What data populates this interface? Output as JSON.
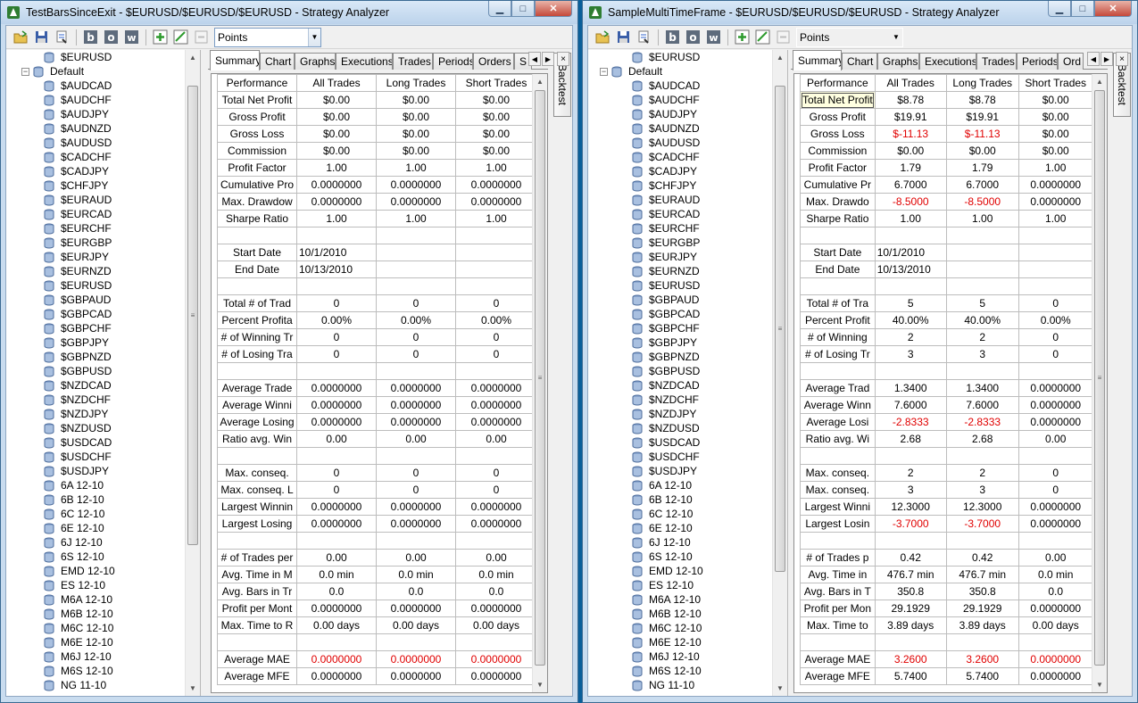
{
  "left_window": {
    "title": "TestBarsSinceExit - $EURUSD/$EURUSD/$EURUSD - Strategy Analyzer",
    "toolbar": {
      "mode_select_value": "Points"
    },
    "tree": {
      "top_item": "$EURUSD",
      "group_label": "Default",
      "items": [
        "$AUDCAD",
        "$AUDCHF",
        "$AUDJPY",
        "$AUDNZD",
        "$AUDUSD",
        "$CADCHF",
        "$CADJPY",
        "$CHFJPY",
        "$EURAUD",
        "$EURCAD",
        "$EURCHF",
        "$EURGBP",
        "$EURJPY",
        "$EURNZD",
        "$EURUSD",
        "$GBPAUD",
        "$GBPCAD",
        "$GBPCHF",
        "$GBPJPY",
        "$GBPNZD",
        "$GBPUSD",
        "$NZDCAD",
        "$NZDCHF",
        "$NZDJPY",
        "$NZDUSD",
        "$USDCAD",
        "$USDCHF",
        "$USDJPY",
        "6A 12-10",
        "6B 12-10",
        "6C 12-10",
        "6E 12-10",
        "6J 12-10",
        "6S 12-10",
        "EMD 12-10",
        "ES 12-10",
        "M6A 12-10",
        "M6B 12-10",
        "M6C 12-10",
        "M6E 12-10",
        "M6J 12-10",
        "M6S 12-10",
        "NG 11-10"
      ]
    },
    "tabs": [
      "Summary",
      "Chart",
      "Graphs",
      "Executions",
      "Trades",
      "Periods",
      "Orders",
      "S"
    ],
    "side_tab": "Backtest",
    "grid": {
      "headers": [
        "Performance",
        "All Trades",
        "Long Trades",
        "Short Trades"
      ],
      "rows": [
        {
          "label": "Total Net Profit",
          "all": "$0.00",
          "long": "$0.00",
          "short": "$0.00"
        },
        {
          "label": "Gross Profit",
          "all": "$0.00",
          "long": "$0.00",
          "short": "$0.00"
        },
        {
          "label": "Gross Loss",
          "all": "$0.00",
          "long": "$0.00",
          "short": "$0.00"
        },
        {
          "label": "Commission",
          "all": "$0.00",
          "long": "$0.00",
          "short": "$0.00"
        },
        {
          "label": "Profit Factor",
          "all": "1.00",
          "long": "1.00",
          "short": "1.00"
        },
        {
          "label": "Cumulative Pro",
          "all": "0.0000000",
          "long": "0.0000000",
          "short": "0.0000000"
        },
        {
          "label": "Max. Drawdow",
          "all": "0.0000000",
          "long": "0.0000000",
          "short": "0.0000000"
        },
        {
          "label": "Sharpe Ratio",
          "all": "1.00",
          "long": "1.00",
          "short": "1.00"
        },
        {
          "blank": true
        },
        {
          "label": "Start Date",
          "all": "10/1/2010",
          "long": "",
          "short": "",
          "left": true
        },
        {
          "label": "End Date",
          "all": "10/13/2010",
          "long": "",
          "short": "",
          "left": true
        },
        {
          "blank": true
        },
        {
          "label": "Total # of Trad",
          "all": "0",
          "long": "0",
          "short": "0"
        },
        {
          "label": "Percent Profita",
          "all": "0.00%",
          "long": "0.00%",
          "short": "0.00%"
        },
        {
          "label": "# of Winning Tr",
          "all": "0",
          "long": "0",
          "short": "0"
        },
        {
          "label": "# of Losing Tra",
          "all": "0",
          "long": "0",
          "short": "0"
        },
        {
          "blank": true
        },
        {
          "label": "Average Trade",
          "all": "0.0000000",
          "long": "0.0000000",
          "short": "0.0000000"
        },
        {
          "label": "Average Winni",
          "all": "0.0000000",
          "long": "0.0000000",
          "short": "0.0000000"
        },
        {
          "label": "Average Losing",
          "all": "0.0000000",
          "long": "0.0000000",
          "short": "0.0000000"
        },
        {
          "label": "Ratio avg. Win",
          "all": "0.00",
          "long": "0.00",
          "short": "0.00"
        },
        {
          "blank": true
        },
        {
          "label": "Max. conseq.",
          "all": "0",
          "long": "0",
          "short": "0"
        },
        {
          "label": "Max. conseq. L",
          "all": "0",
          "long": "0",
          "short": "0"
        },
        {
          "label": "Largest Winnin",
          "all": "0.0000000",
          "long": "0.0000000",
          "short": "0.0000000"
        },
        {
          "label": "Largest Losing",
          "all": "0.0000000",
          "long": "0.0000000",
          "short": "0.0000000"
        },
        {
          "blank": true
        },
        {
          "label": "# of Trades per",
          "all": "0.00",
          "long": "0.00",
          "short": "0.00"
        },
        {
          "label": "Avg. Time in M",
          "all": "0.0 min",
          "long": "0.0 min",
          "short": "0.0 min"
        },
        {
          "label": "Avg. Bars in Tr",
          "all": "0.0",
          "long": "0.0",
          "short": "0.0"
        },
        {
          "label": "Profit per Mont",
          "all": "0.0000000",
          "long": "0.0000000",
          "short": "0.0000000"
        },
        {
          "label": "Max. Time to R",
          "all": "0.00 days",
          "long": "0.00 days",
          "short": "0.00 days"
        },
        {
          "blank": true
        },
        {
          "label": "Average MAE",
          "all": "0.0000000",
          "long": "0.0000000",
          "short": "0.0000000",
          "red": true
        },
        {
          "label": "Average MFE",
          "all": "0.0000000",
          "long": "0.0000000",
          "short": "0.0000000"
        }
      ]
    }
  },
  "right_window": {
    "title": "SampleMultiTimeFrame - $EURUSD/$EURUSD/$EURUSD - Strategy Analyzer",
    "toolbar": {
      "mode_select_value": "Points"
    },
    "tree": {
      "top_item": "$EURUSD",
      "group_label": "Default",
      "items": [
        "$AUDCAD",
        "$AUDCHF",
        "$AUDJPY",
        "$AUDNZD",
        "$AUDUSD",
        "$CADCHF",
        "$CADJPY",
        "$CHFJPY",
        "$EURAUD",
        "$EURCAD",
        "$EURCHF",
        "$EURGBP",
        "$EURJPY",
        "$EURNZD",
        "$EURUSD",
        "$GBPAUD",
        "$GBPCAD",
        "$GBPCHF",
        "$GBPJPY",
        "$GBPNZD",
        "$GBPUSD",
        "$NZDCAD",
        "$NZDCHF",
        "$NZDJPY",
        "$NZDUSD",
        "$USDCAD",
        "$USDCHF",
        "$USDJPY",
        "6A 12-10",
        "6B 12-10",
        "6C 12-10",
        "6E 12-10",
        "6J 12-10",
        "6S 12-10",
        "EMD 12-10",
        "ES 12-10",
        "M6A 12-10",
        "M6B 12-10",
        "M6C 12-10",
        "M6E 12-10",
        "M6J 12-10",
        "M6S 12-10",
        "NG 11-10"
      ]
    },
    "tabs": [
      "Summary",
      "Chart",
      "Graphs",
      "Executions",
      "Trades",
      "Periods",
      "Ord"
    ],
    "side_tab": "Backtest",
    "grid": {
      "headers": [
        "Performance",
        "All Trades",
        "Long Trades",
        "Short Trades"
      ],
      "rows": [
        {
          "label": "Total Net Profit",
          "all": "$8.78",
          "long": "$8.78",
          "short": "$0.00",
          "selected": true
        },
        {
          "label": "Gross Profit",
          "all": "$19.91",
          "long": "$19.91",
          "short": "$0.00"
        },
        {
          "label": "Gross Loss",
          "all": "$-11.13",
          "long": "$-11.13",
          "short": "$0.00",
          "neg_all": true,
          "neg_long": true
        },
        {
          "label": "Commission",
          "all": "$0.00",
          "long": "$0.00",
          "short": "$0.00"
        },
        {
          "label": "Profit Factor",
          "all": "1.79",
          "long": "1.79",
          "short": "1.00"
        },
        {
          "label": "Cumulative Pr",
          "all": "6.7000",
          "long": "6.7000",
          "short": "0.0000000"
        },
        {
          "label": "Max. Drawdo",
          "all": "-8.5000",
          "long": "-8.5000",
          "short": "0.0000000",
          "neg_all": true,
          "neg_long": true
        },
        {
          "label": "Sharpe Ratio",
          "all": "1.00",
          "long": "1.00",
          "short": "1.00"
        },
        {
          "blank": true
        },
        {
          "label": "Start Date",
          "all": "10/1/2010",
          "long": "",
          "short": "",
          "left": true
        },
        {
          "label": "End Date",
          "all": "10/13/2010",
          "long": "",
          "short": "",
          "left": true
        },
        {
          "blank": true
        },
        {
          "label": "Total # of Tra",
          "all": "5",
          "long": "5",
          "short": "0"
        },
        {
          "label": "Percent Profit",
          "all": "40.00%",
          "long": "40.00%",
          "short": "0.00%"
        },
        {
          "label": "# of Winning",
          "all": "2",
          "long": "2",
          "short": "0"
        },
        {
          "label": "# of Losing Tr",
          "all": "3",
          "long": "3",
          "short": "0"
        },
        {
          "blank": true
        },
        {
          "label": "Average Trad",
          "all": "1.3400",
          "long": "1.3400",
          "short": "0.0000000"
        },
        {
          "label": "Average Winn",
          "all": "7.6000",
          "long": "7.6000",
          "short": "0.0000000"
        },
        {
          "label": "Average Losi",
          "all": "-2.8333",
          "long": "-2.8333",
          "short": "0.0000000",
          "neg_all": true,
          "neg_long": true
        },
        {
          "label": "Ratio avg. Wi",
          "all": "2.68",
          "long": "2.68",
          "short": "0.00"
        },
        {
          "blank": true
        },
        {
          "label": "Max. conseq.",
          "all": "2",
          "long": "2",
          "short": "0"
        },
        {
          "label": "Max. conseq.",
          "all": "3",
          "long": "3",
          "short": "0"
        },
        {
          "label": "Largest Winni",
          "all": "12.3000",
          "long": "12.3000",
          "short": "0.0000000"
        },
        {
          "label": "Largest Losin",
          "all": "-3.7000",
          "long": "-3.7000",
          "short": "0.0000000",
          "neg_all": true,
          "neg_long": true
        },
        {
          "blank": true
        },
        {
          "label": "# of Trades p",
          "all": "0.42",
          "long": "0.42",
          "short": "0.00"
        },
        {
          "label": "Avg. Time in",
          "all": "476.7 min",
          "long": "476.7 min",
          "short": "0.0 min"
        },
        {
          "label": "Avg. Bars in T",
          "all": "350.8",
          "long": "350.8",
          "short": "0.0"
        },
        {
          "label": "Profit per Mon",
          "all": "29.1929",
          "long": "29.1929",
          "short": "0.0000000"
        },
        {
          "label": "Max. Time to",
          "all": "3.89 days",
          "long": "3.89 days",
          "short": "0.00 days"
        },
        {
          "blank": true
        },
        {
          "label": "Average MAE",
          "all": "3.2600",
          "long": "3.2600",
          "short": "0.0000000",
          "red": true
        },
        {
          "label": "Average MFE",
          "all": "5.7400",
          "long": "5.7400",
          "short": "0.0000000"
        }
      ]
    }
  },
  "colors": {
    "negative_text": "#e00000",
    "desktop_bg": "#0a5f9a",
    "window_frame": "#c9dcef"
  }
}
